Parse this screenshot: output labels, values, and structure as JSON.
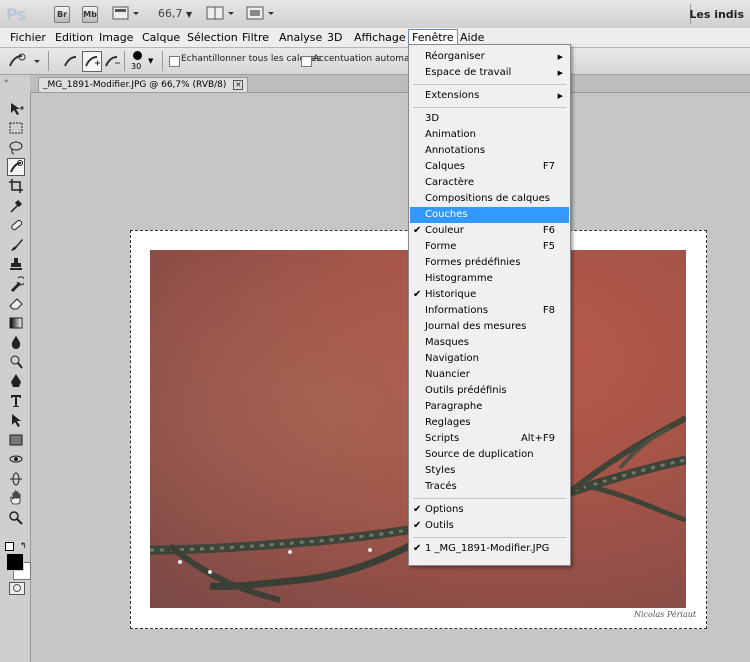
{
  "app": {
    "logo": "Ps",
    "buttons": [
      "Br",
      "Mb"
    ],
    "zoom": "66,7",
    "workspace": "Les indis"
  },
  "menubar": [
    "Fichier",
    "Edition",
    "Image",
    "Calque",
    "Sélection",
    "Filtre",
    "Analyse",
    "3D",
    "Affichage",
    "Fenêtre",
    "Aide"
  ],
  "options": {
    "brush_size": "30",
    "sample_all_label": "Echantillonner tous les calques",
    "auto_enhance_label": "Accentuation automatiq"
  },
  "document": {
    "tab_title": "_MG_1891-Modifier.JPG @ 66,7% (RVB/8)",
    "signature": "Nicolas Périaut"
  },
  "window_menu": {
    "items": [
      {
        "label": "Réorganiser",
        "submenu": true
      },
      {
        "label": "Espace de travail",
        "submenu": true
      },
      {
        "sep": true
      },
      {
        "label": "Extensions",
        "submenu": true
      },
      {
        "sep": true
      },
      {
        "label": "3D"
      },
      {
        "label": "Animation"
      },
      {
        "label": "Annotations"
      },
      {
        "label": "Calques",
        "shortcut": "F7"
      },
      {
        "label": "Caractère"
      },
      {
        "label": "Compositions de calques"
      },
      {
        "label": "Couches",
        "highlighted": true
      },
      {
        "label": "Couleur",
        "shortcut": "F6",
        "checked": true
      },
      {
        "label": "Forme",
        "shortcut": "F5"
      },
      {
        "label": "Formes prédéfinies"
      },
      {
        "label": "Histogramme"
      },
      {
        "label": "Historique",
        "checked": true
      },
      {
        "label": "Informations",
        "shortcut": "F8"
      },
      {
        "label": "Journal des mesures"
      },
      {
        "label": "Masques"
      },
      {
        "label": "Navigation"
      },
      {
        "label": "Nuancier"
      },
      {
        "label": "Outils prédéfinis"
      },
      {
        "label": "Paragraphe"
      },
      {
        "label": "Reglages"
      },
      {
        "label": "Scripts",
        "shortcut": "Alt+F9"
      },
      {
        "label": "Source de duplication"
      },
      {
        "label": "Styles"
      },
      {
        "label": "Tracés"
      },
      {
        "sep": true
      },
      {
        "label": "Options",
        "checked": true
      },
      {
        "label": "Outils",
        "checked": true
      },
      {
        "sep": true
      },
      {
        "label": "1 _MG_1891-Modifier.JPG",
        "checked": true
      }
    ]
  },
  "tools": [
    "move-icon",
    "marquee-icon",
    "lasso-icon",
    "quick-selection-icon",
    "crop-icon",
    "eyedropper-icon",
    "healing-brush-icon",
    "brush-icon",
    "clone-stamp-icon",
    "history-brush-icon",
    "eraser-icon",
    "gradient-icon",
    "blur-icon",
    "dodge-icon",
    "pen-icon",
    "type-icon",
    "path-selection-icon",
    "shape-icon",
    "3d-rotate-icon",
    "3d-orbit-icon",
    "hand-icon",
    "zoom-icon"
  ],
  "colors": {
    "highlight": "#3399ff",
    "foreground": "#000000",
    "background": "#ffffff"
  }
}
